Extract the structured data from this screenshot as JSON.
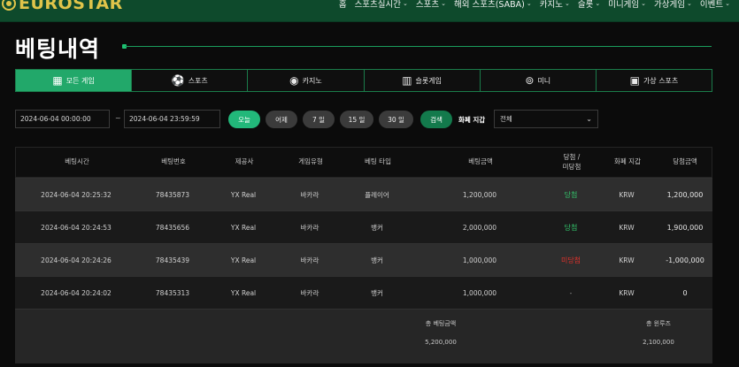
{
  "brand": {
    "name": "EUROSTAR"
  },
  "nav": {
    "items": [
      {
        "label": "홈",
        "chevron": false
      },
      {
        "label": "스포츠실시간",
        "chevron": true
      },
      {
        "label": "스포츠",
        "chevron": true
      },
      {
        "label": "해외 스포츠(SABA)",
        "chevron": true
      },
      {
        "label": "카지노",
        "chevron": true
      },
      {
        "label": "슬롯",
        "chevron": true
      },
      {
        "label": "미니게임",
        "chevron": true
      },
      {
        "label": "가상게임",
        "chevron": true
      },
      {
        "label": "이벤트",
        "chevron": true
      }
    ]
  },
  "page": {
    "title": "베팅내역"
  },
  "tabs": [
    {
      "label": "모든 게임",
      "icon": "grid-icon",
      "active": true
    },
    {
      "label": "스포츠",
      "icon": "soccer-ball-icon",
      "active": false
    },
    {
      "label": "카지노",
      "icon": "casino-chip-icon",
      "active": false
    },
    {
      "label": "슬롯게임",
      "icon": "slot-machine-icon",
      "active": false
    },
    {
      "label": "미니",
      "icon": "gamepad-icon",
      "active": false
    },
    {
      "label": "가상 스포츠",
      "icon": "vr-icon",
      "active": false
    }
  ],
  "filters": {
    "start_date": "2024-06-04 00:00:00",
    "separator": "~",
    "end_date": "2024-06-04 23:59:59",
    "quick": [
      "오늘",
      "어제",
      "7 일",
      "15 일",
      "30 일"
    ],
    "search_label": "검색",
    "currency_label": "화폐 지갑",
    "currency_value": "전체"
  },
  "table": {
    "headers": [
      "베팅시간",
      "베팅번호",
      "제공사",
      "게임유형",
      "베팅 타입",
      "베팅금액",
      "당첨 /\n미당첨",
      "화폐 지갑",
      "당첨금액"
    ],
    "rows": [
      {
        "time": "2024-06-04 20:25:32",
        "id": "78435873",
        "provider": "YX Real",
        "game": "바카라",
        "bet_type": "플레이어",
        "amount": "1,200,000",
        "result": "당첨",
        "result_state": "win",
        "wallet": "KRW",
        "payout": "1,200,000",
        "payout_state": "normal"
      },
      {
        "time": "2024-06-04 20:24:53",
        "id": "78435656",
        "provider": "YX Real",
        "game": "바카라",
        "bet_type": "뱅커",
        "amount": "2,000,000",
        "result": "당첨",
        "result_state": "win",
        "wallet": "KRW",
        "payout": "1,900,000",
        "payout_state": "normal"
      },
      {
        "time": "2024-06-04 20:24:26",
        "id": "78435439",
        "provider": "YX Real",
        "game": "바카라",
        "bet_type": "뱅커",
        "amount": "1,000,000",
        "result": "미당첨",
        "result_state": "lose",
        "wallet": "KRW",
        "payout": "-1,000,000",
        "payout_state": "negative"
      },
      {
        "time": "2024-06-04 20:24:02",
        "id": "78435313",
        "provider": "YX Real",
        "game": "바카라",
        "bet_type": "뱅커",
        "amount": "1,000,000",
        "result": "-",
        "result_state": "pending",
        "wallet": "KRW",
        "payout": "0",
        "payout_state": "normal"
      }
    ],
    "summary": {
      "total_bet_label": "총 베팅금액",
      "total_bet_value": "5,200,000",
      "total_win_label": "총 윈루즈",
      "total_win_value": "2,100,000"
    }
  },
  "colors": {
    "accent": "#22a86a",
    "header_bg": "#0e4a2c",
    "win": "#33c46b",
    "lose": "#e0322b",
    "brand_gold": "#e0c44a"
  }
}
